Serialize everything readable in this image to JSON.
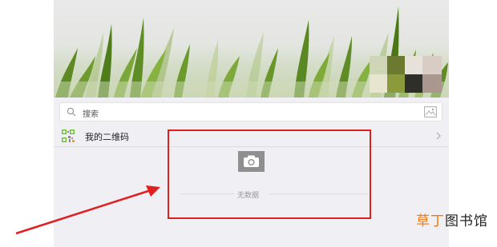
{
  "search": {
    "label": "搜索"
  },
  "qr_row": {
    "label": "我的二维码"
  },
  "empty_state": {
    "text": "无数据"
  },
  "watermark": {
    "part1": "草丁",
    "part2": "图书馆"
  },
  "colors": {
    "highlight": "#e02020",
    "watermark_accent": "#ee7a17",
    "grass": "#6f9a2e",
    "background": "#efeff4"
  },
  "icons": [
    "search-icon",
    "image-icon",
    "qr-code-icon",
    "chevron-right-icon",
    "camera-icon",
    "arrow"
  ]
}
